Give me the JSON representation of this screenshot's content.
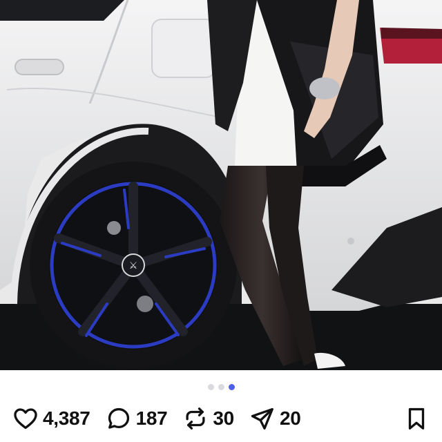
{
  "post": {
    "image_icon": "photo-post-image",
    "carousel": {
      "total": 3,
      "active_index": 2
    },
    "stats": {
      "likes": "4,387",
      "comments": "187",
      "reposts": "30",
      "shares": "20"
    },
    "icons": {
      "like": "heart-icon",
      "comment": "comment-bubble-icon",
      "repost": "repost-icon",
      "share": "send-icon",
      "save": "bookmark-icon"
    },
    "colors": {
      "active_dot": "#4e5fe8",
      "inactive_dot": "#d9d9de",
      "icon": "#111111"
    }
  }
}
